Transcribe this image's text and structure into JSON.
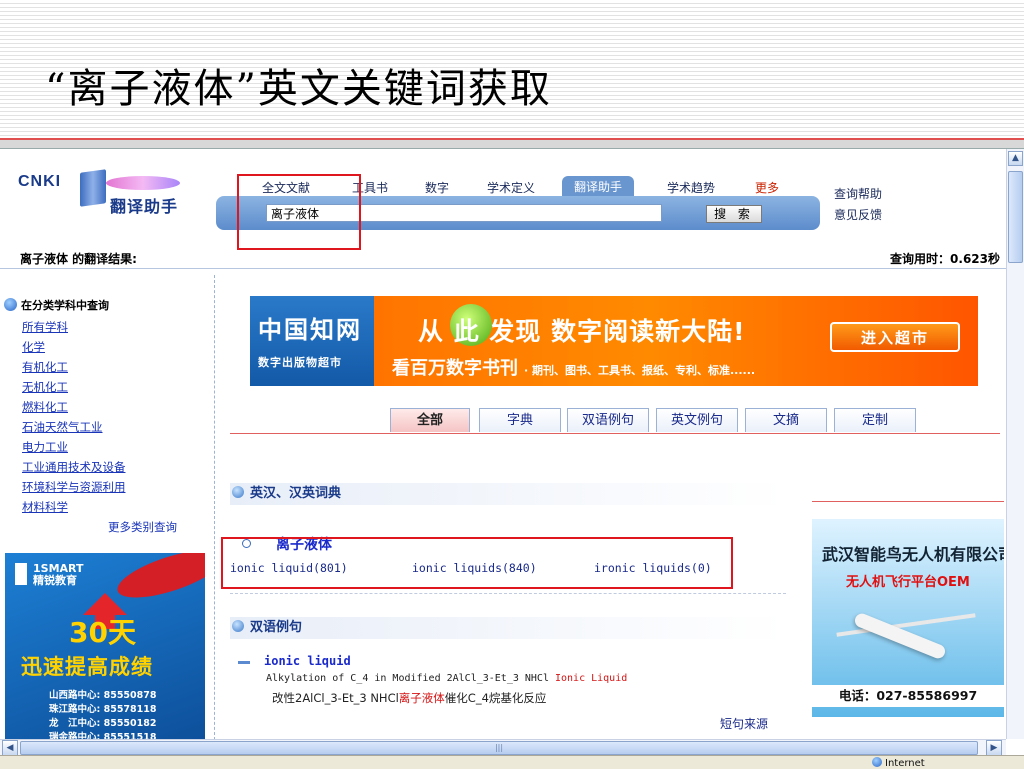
{
  "slide": {
    "title": "“离子液体”英文关键词获取"
  },
  "header": {
    "logo_text": "CNKI",
    "logo_sub": "翻译助手",
    "nav_tabs": [
      "全文文献",
      "工具书",
      "数字",
      "学术定义",
      "翻译助手",
      "学术趋势",
      "更多"
    ],
    "active_tab": "翻译助手",
    "search_value": "离子液体",
    "search_button": "搜 索",
    "help_links": [
      "查询帮助",
      "意见反馈"
    ]
  },
  "results": {
    "label": "离子液体 的翻译结果:",
    "query_time": "查询用时：0.623秒"
  },
  "sidebar": {
    "header": "在分类学科中查询",
    "categories": [
      "所有学科",
      "化学",
      "有机化工",
      "无机化工",
      "燃料化工",
      "石油天然气工业",
      "电力工业",
      "工业通用技术及设备",
      "环境科学与资源利用",
      "材料科学"
    ],
    "more": "更多类别查询"
  },
  "ad_left": {
    "brand_en": "1SMART",
    "brand_zh": "精锐教育",
    "big": "30天",
    "slogan": "迅速提高成绩",
    "phones": [
      "山西路中心: 85550878",
      "珠江路中心: 85578118",
      "龙　江中心: 85550182",
      "瑞金路中心: 85551518"
    ]
  },
  "banner": {
    "brand": "中国知网",
    "brand_sub": "数字出版物超市",
    "headline": "从 此 发现 数字阅读新大陆!",
    "subline": "看百万数字书刊",
    "subline_small": "· 期刊、图书、工具书、报纸、专利、标准......",
    "button": "进入超市"
  },
  "result_tabs": [
    "全部",
    "字典",
    "双语例句",
    "英文例句",
    "文摘",
    "定制"
  ],
  "active_result_tab": "全部",
  "dictionary": {
    "section_title": "英汉、汉英词典",
    "term": "离子液体",
    "translations": [
      "ionic liquid(801)",
      "ionic liquids(840)",
      "ironic liquids(0)"
    ]
  },
  "bilingual": {
    "section_title": "双语例句",
    "term": "ionic liquid",
    "en_prefix": "Alkylation of C_4 in Modified 2AlCl_3-Et_3 NHCl ",
    "en_highlight": "Ionic Liquid",
    "zh_prefix": "改性2AlCl_3-Et_3 NHCl",
    "zh_highlight": "离子液体",
    "zh_suffix": "催化C_4烷基化反应",
    "source": "短句来源"
  },
  "ad_right": {
    "title": "武汉智能鸟无人机有限公司",
    "subtitle": "无人机飞行平台OEM",
    "phone": "电话：027-85586997"
  },
  "statusbar": {
    "zone": "Internet"
  },
  "colors": {
    "highlight_box": "#e0161e",
    "nav_accent": "#6a96cf",
    "banner_orange": "#ff6a00"
  }
}
